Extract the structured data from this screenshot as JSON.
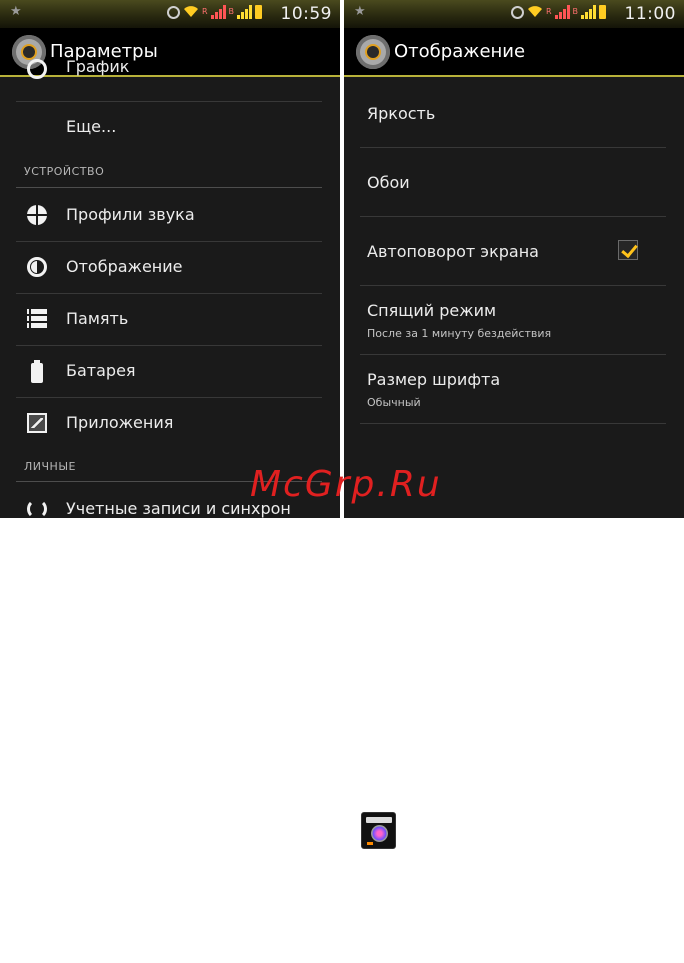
{
  "left_screen": {
    "status": {
      "time": "10:59"
    },
    "title": "Параметры",
    "partial_item": "График",
    "more_item": "Еще...",
    "section_device": "УСТРОЙСТВО",
    "items": [
      {
        "label": "Профили звука",
        "icon": "sound-profile-icon"
      },
      {
        "label": "Отображение",
        "icon": "display-icon"
      },
      {
        "label": "Память",
        "icon": "storage-icon"
      },
      {
        "label": "Батарея",
        "icon": "battery-icon"
      },
      {
        "label": "Приложения",
        "icon": "apps-icon"
      }
    ],
    "section_personal": "ЛИЧНЫЕ",
    "accounts_item": "Учетные записи и синхрон"
  },
  "right_screen": {
    "status": {
      "time": "11:00"
    },
    "title": "Отображение",
    "brightness": "Яркость",
    "wallpaper": "Обои",
    "auto_rotate": {
      "label": "Автоповорот экрана",
      "checked": true
    },
    "sleep": {
      "label": "Спящий режим",
      "summary": "После за 1 минуту бездействия"
    },
    "font_size": {
      "label": "Размер шрифта",
      "summary": "Обычный"
    }
  },
  "watermark": "McGrp.Ru",
  "colors": {
    "accent": "#ffc21a",
    "actionbar_underline": "#b8b23a",
    "background": "#1a1a1a"
  }
}
